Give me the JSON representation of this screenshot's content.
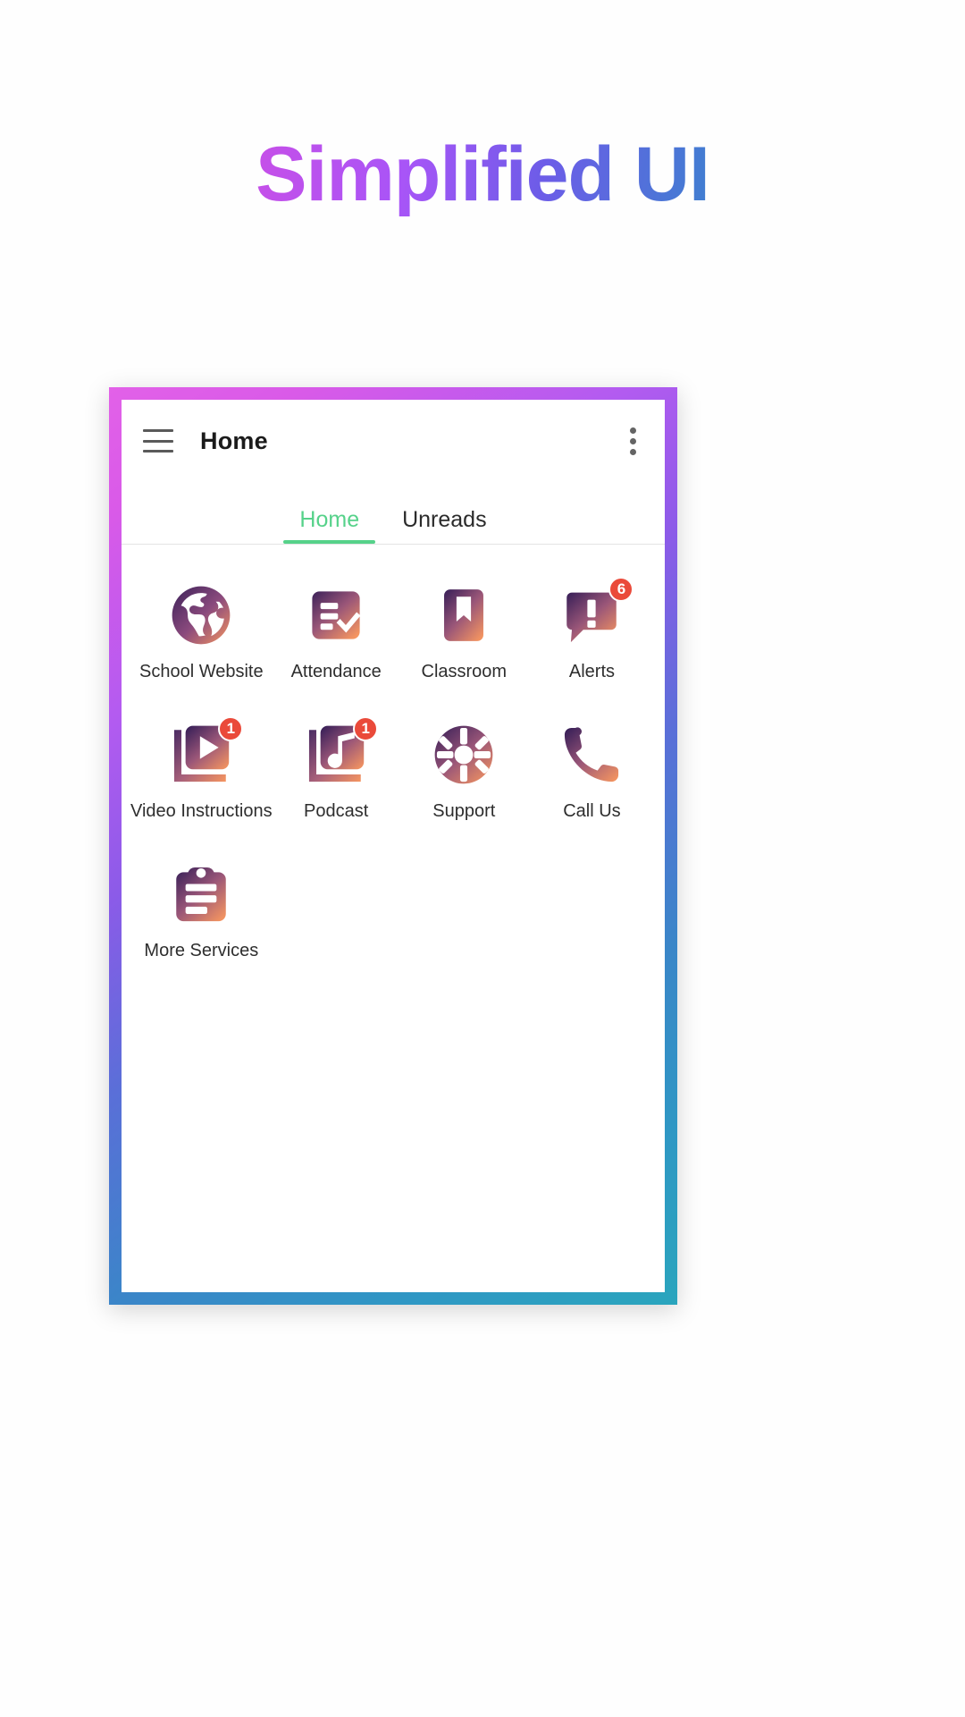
{
  "headline": "Simplified UI",
  "theme": {
    "gradient_start": "#e754d8",
    "gradient_mid": "#6d5ce8",
    "gradient_end": "#1fa5b5",
    "accent_green": "#56d28a",
    "badge_red": "#ea4a3a",
    "icon_gradient_start": "#3b2159",
    "icon_gradient_end": "#f59560"
  },
  "appbar": {
    "menu_icon": "hamburger-menu-icon",
    "title": "Home",
    "overflow_icon": "more-vertical-icon"
  },
  "tabs": [
    {
      "label": "Home",
      "active": true
    },
    {
      "label": "Unreads",
      "active": false
    }
  ],
  "grid": {
    "items": [
      {
        "label": "School Website",
        "icon": "globe-icon",
        "badge": ""
      },
      {
        "label": "Attendance",
        "icon": "checklist-icon",
        "badge": ""
      },
      {
        "label": "Classroom",
        "icon": "bookmark-icon",
        "badge": ""
      },
      {
        "label": "Alerts",
        "icon": "alert-bubble-icon",
        "badge": "6"
      },
      {
        "label": "Video Instructions",
        "icon": "video-library-icon",
        "badge": "1"
      },
      {
        "label": "Podcast",
        "icon": "music-library-icon",
        "badge": "1"
      },
      {
        "label": "Support",
        "icon": "lifebuoy-icon",
        "badge": ""
      },
      {
        "label": "Call Us",
        "icon": "phone-icon",
        "badge": ""
      },
      {
        "label": "More Services",
        "icon": "clipboard-icon",
        "badge": ""
      }
    ]
  }
}
